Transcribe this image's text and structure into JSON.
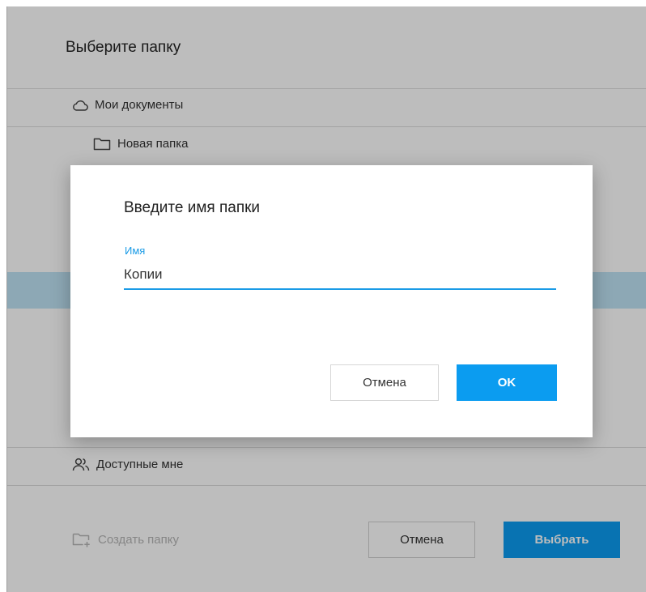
{
  "folder_picker": {
    "title": "Выберите папку",
    "tree": [
      {
        "label": "Мои документы",
        "icon": "cloud-icon"
      },
      {
        "label": "Новая папка",
        "icon": "folder-icon"
      }
    ],
    "shared_label": "Доступные мне",
    "create_folder_label": "Создать папку",
    "cancel_label": "Отмена",
    "choose_label": "Выбрать"
  },
  "new_folder_dialog": {
    "title": "Введите имя папки",
    "field_label": "Имя",
    "field_value": "Копии",
    "cancel_label": "Отмена",
    "ok_label": "OK"
  },
  "colors": {
    "accent": "#0b9cf0",
    "selected_row": "#bfe3f5",
    "field_focus": "#1a9be6"
  }
}
